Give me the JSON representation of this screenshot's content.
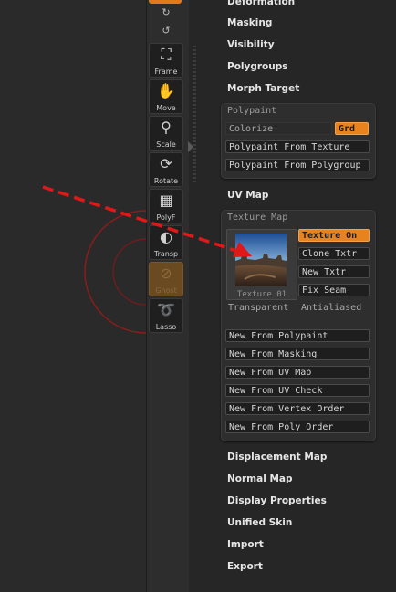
{
  "top_menu": [
    "Deformation",
    "Masking",
    "Visibility",
    "Polygroups",
    "Morph Target"
  ],
  "polypaint": {
    "title": "Polypaint",
    "colorize": "Colorize",
    "grd": "Grd",
    "from_texture": "Polypaint From Texture",
    "from_polygroup": "Polypaint From Polygroup"
  },
  "uv_map": "UV Map",
  "texture_map": {
    "title": "Texture Map",
    "thumb_caption": "Texture 01",
    "texture_on": "Texture On",
    "clone_txtr": "Clone Txtr",
    "new_txtr": "New Txtr",
    "fix_seam": "Fix Seam",
    "transparent": "Transparent",
    "antialiased": "Antialiased",
    "new_buttons": [
      "New From Polypaint",
      "New From Masking",
      "New From UV Map",
      "New From UV Check",
      "New From Vertex Order",
      "New From Poly Order"
    ]
  },
  "bottom_menu": [
    "Displacement Map",
    "Normal Map",
    "Display Properties",
    "Unified Skin",
    "Import",
    "Export"
  ],
  "tools": [
    {
      "label": "Frame",
      "icon": "frame-icon"
    },
    {
      "label": "Move",
      "icon": "move-hand-icon"
    },
    {
      "label": "Scale",
      "icon": "zoom-icon"
    },
    {
      "label": "Rotate",
      "icon": "rotate-icon"
    },
    {
      "label": "PolyF",
      "icon": "polyframe-icon"
    },
    {
      "label": "Transp",
      "icon": "transparency-icon"
    },
    {
      "label": "Ghost",
      "icon": "ghost-icon"
    },
    {
      "label": "Lasso",
      "icon": "lasso-icon"
    }
  ],
  "colors": {
    "accent": "#e8821c",
    "annotation": "#e01818",
    "panel": "#2e2e2e",
    "background": "#262626"
  }
}
